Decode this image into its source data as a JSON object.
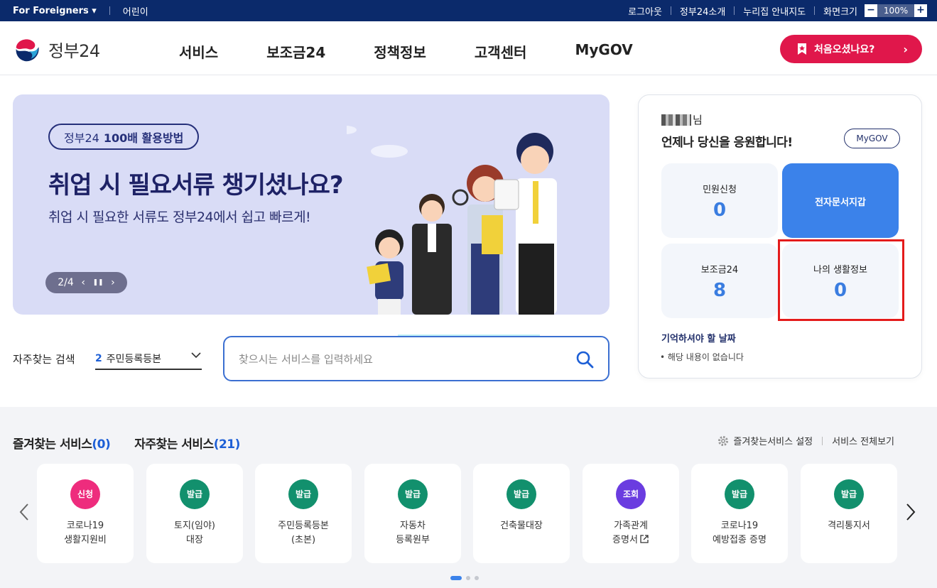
{
  "topbar": {
    "foreigners": "For Foreigners ▾",
    "kids": "어린이",
    "logout": "로그아웃",
    "intro": "정부24소개",
    "sitemap": "누리집 안내지도",
    "screen_size": "화면크기",
    "zoom_minus": "−",
    "zoom_value": "100%",
    "zoom_plus": "+"
  },
  "header": {
    "logo_text": "정부24",
    "nav": [
      "서비스",
      "보조금24",
      "정책정보",
      "고객센터",
      "MyGOV"
    ],
    "first_visit": "처음오셨나요?",
    "chevron": "›"
  },
  "banner": {
    "badge_prefix": "정부24",
    "badge_bold": "100배 활용방법",
    "title": "취업 시 필요서류 챙기셨나요?",
    "subtitle": "취업 시 필요한 서류도 정부24에서 쉽고 빠르게!",
    "pager": "2/4",
    "prev": "‹",
    "pause": "❚❚",
    "next": "›"
  },
  "search": {
    "frequent_label": "자주찾는 검색",
    "frequent_num": "2",
    "frequent_value": "주민등록등본",
    "placeholder": "찾으시는 서비스를 입력하세요"
  },
  "user_panel": {
    "name_suffix": "님",
    "greeting": "언제나 당신을 응원합니다!",
    "mygov": "MyGOV",
    "tiles": [
      {
        "label": "민원신청",
        "value": "0"
      },
      {
        "label": "전자문서지갑"
      },
      {
        "label": "보조금24",
        "value": "8"
      },
      {
        "label": "나의 생활정보",
        "value": "0"
      }
    ],
    "remember_title": "기억하셔야 할 날짜",
    "remember_empty": "해당 내용이 없습니다"
  },
  "services": {
    "tab_favorite": "즐겨찾는 서비스",
    "tab_favorite_count": "(0)",
    "tab_frequent": "자주찾는 서비스",
    "tab_frequent_count": "(21)",
    "settings": "즐겨찾는서비스 설정",
    "view_all": "서비스 전체보기",
    "cards": [
      {
        "badge": "신청",
        "color": "#ee2c7d",
        "name": "코로나19\n생활지원비"
      },
      {
        "badge": "발급",
        "color": "#12906d",
        "name": "토지(임야)\n대장"
      },
      {
        "badge": "발급",
        "color": "#12906d",
        "name": "주민등록등본\n(초본)"
      },
      {
        "badge": "발급",
        "color": "#12906d",
        "name": "자동차\n등록원부"
      },
      {
        "badge": "발급",
        "color": "#12906d",
        "name": "건축물대장"
      },
      {
        "badge": "조회",
        "color": "#6a3ce0",
        "name": "가족관계\n증명서"
      },
      {
        "badge": "발급",
        "color": "#12906d",
        "name": "코로나19\n예방접종 증명"
      },
      {
        "badge": "발급",
        "color": "#12906d",
        "name": "격리통지서"
      }
    ]
  },
  "colors": {
    "navy": "#0b2a6b",
    "accent_red": "#e0174b",
    "accent_blue": "#3b82ea",
    "banner_bg": "#d9dcf6"
  }
}
